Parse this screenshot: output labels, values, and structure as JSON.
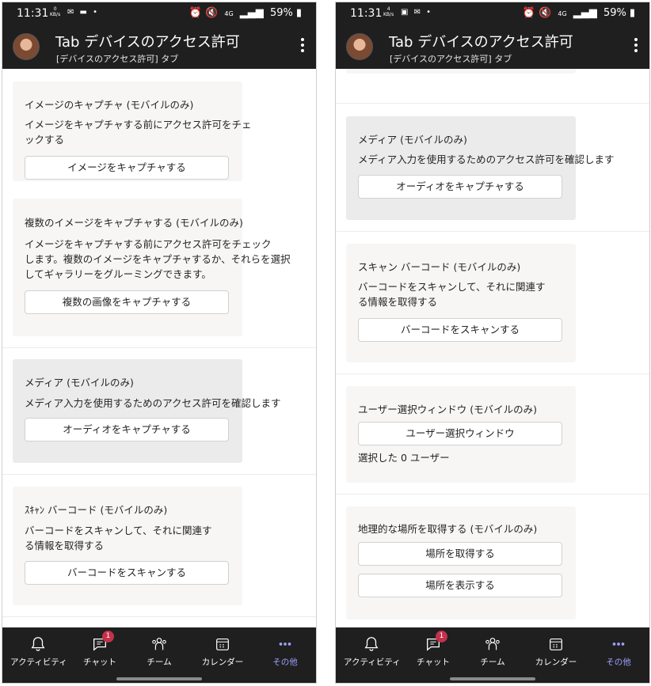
{
  "status": {
    "left": {
      "time": "11:31",
      "net_speed": "0",
      "net_unit": "KB/s"
    },
    "right": {
      "time": "11:31",
      "net_speed": "4",
      "net_unit": "KB/s"
    },
    "signal": "4G",
    "battery": "59%"
  },
  "header": {
    "title": "Tab デバイスのアクセス許可",
    "subtitle": "[デバイスのアクセス許可] タブ"
  },
  "left_cards": {
    "image_capture": {
      "title": "イメージのキャプチャ (モバイルのみ)",
      "desc_line1": "イメージをキャプチャする前にアクセス許可をチェ",
      "desc_line2": "ックする",
      "button": "イメージをキャプチャする"
    },
    "multi_capture": {
      "title": "複数のイメージをキャプチャする (モバイルのみ)",
      "desc_line1": "イメージをキャプチャする前にアクセス許可をチェック",
      "desc_line2": "します。複数のイメージをキャプチャするか、それらを選択",
      "desc_line3": "してギャラリーをグルーミングできます。",
      "button": "複数の画像をキャプチャする"
    },
    "media": {
      "title": "メディア (モバイルのみ)",
      "desc": "メディア入力を使用するためのアクセス許可を確認します",
      "button": "オーディオをキャプチャする"
    },
    "barcode": {
      "title": "ｽｷｬﾝ バーコード (モバイルのみ)",
      "desc_line1": "バーコードをスキャンして、それに関連す",
      "desc_line2": "る情報を取得する",
      "button": "バーコードをスキャンする"
    }
  },
  "right_cards": {
    "media": {
      "title": "メディア (モバイルのみ)",
      "desc": "メディア入力を使用するためのアクセス許可を確認します",
      "button": "オーディオをキャプチャする"
    },
    "barcode": {
      "title": "スキャン バーコード (モバイルのみ)",
      "desc_line1": "バーコードをスキャンして、それに関連す",
      "desc_line2": "る情報を取得する",
      "button": "バーコードをスキャンする"
    },
    "people_picker": {
      "title": "ユーザー選択ウィンドウ (モバイルのみ)",
      "button": "ユーザー選択ウィンドウ",
      "result": "選択した 0 ユーザー"
    },
    "location": {
      "title": "地理的な場所を取得する (モバイルのみ)",
      "button_get": "場所を取得する",
      "button_show": "場所を表示する"
    }
  },
  "tabs": {
    "activity": "アクティビティ",
    "chat": "チャット",
    "chat_badge": "1",
    "teams": "チーム",
    "calendar": "カレンダー",
    "more": "その他"
  },
  "colors": {
    "bar_background": "#1f1f1f",
    "card_background": "#f7f6f5",
    "card_active_background": "#ebebeb",
    "badge": "#c4314b",
    "active_tab": "#9ea2ff"
  }
}
